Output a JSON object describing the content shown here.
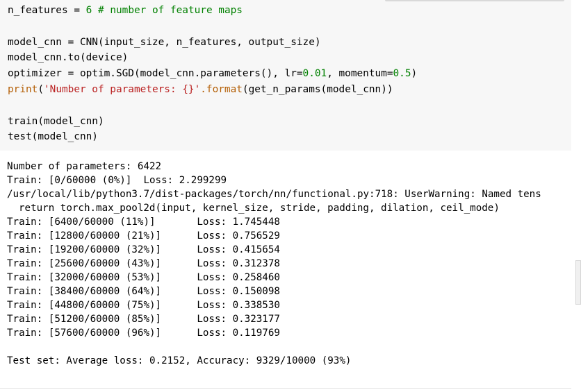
{
  "code_cell": {
    "line1": {
      "var": "n_features",
      "eq": "=",
      "val": "6",
      "comment": "# number of feature maps"
    },
    "line2": {
      "pre": "model_cnn = CNN(input_size, n_features, output_size)"
    },
    "line3": {
      "pre": "model_cnn.to(device)"
    },
    "line4": {
      "pre": "optimizer = optim.SGD(model_cnn.parameters(), lr=",
      "lr": "0.01",
      "mid": ", momentum=",
      "mom": "0.5",
      "post": ")"
    },
    "line5": {
      "kw": "print",
      "open": "(",
      "str": "'Number of parameters: {}'",
      "method": ".format",
      "rest": "(get_n_params(model_cnn))"
    },
    "line6": {
      "pre": "train(model_cnn)"
    },
    "line7": {
      "pre": "test(model_cnn)"
    }
  },
  "output_lines": [
    "Number of parameters: 6422",
    "Train: [0/60000 (0%)]  Loss: 2.299299",
    "/usr/local/lib/python3.7/dist-packages/torch/nn/functional.py:718: UserWarning: Named tens",
    "return torch.max_pool2d(input, kernel_size, stride, padding, dilation, ceil_mode)",
    "Train: [6400/60000 (11%)]       Loss: 1.745448",
    "Train: [12800/60000 (21%)]      Loss: 0.756529",
    "Train: [19200/60000 (32%)]      Loss: 0.415654",
    "Train: [25600/60000 (43%)]      Loss: 0.312378",
    "Train: [32000/60000 (53%)]      Loss: 0.258460",
    "Train: [38400/60000 (64%)]      Loss: 0.150098",
    "Train: [44800/60000 (75%)]      Loss: 0.338530",
    "Train: [51200/60000 (85%)]      Loss: 0.323177",
    "Train: [57600/60000 (96%)]      Loss: 0.119769",
    "",
    "Test set: Average loss: 0.2152, Accuracy: 9329/10000 (93%)"
  ]
}
